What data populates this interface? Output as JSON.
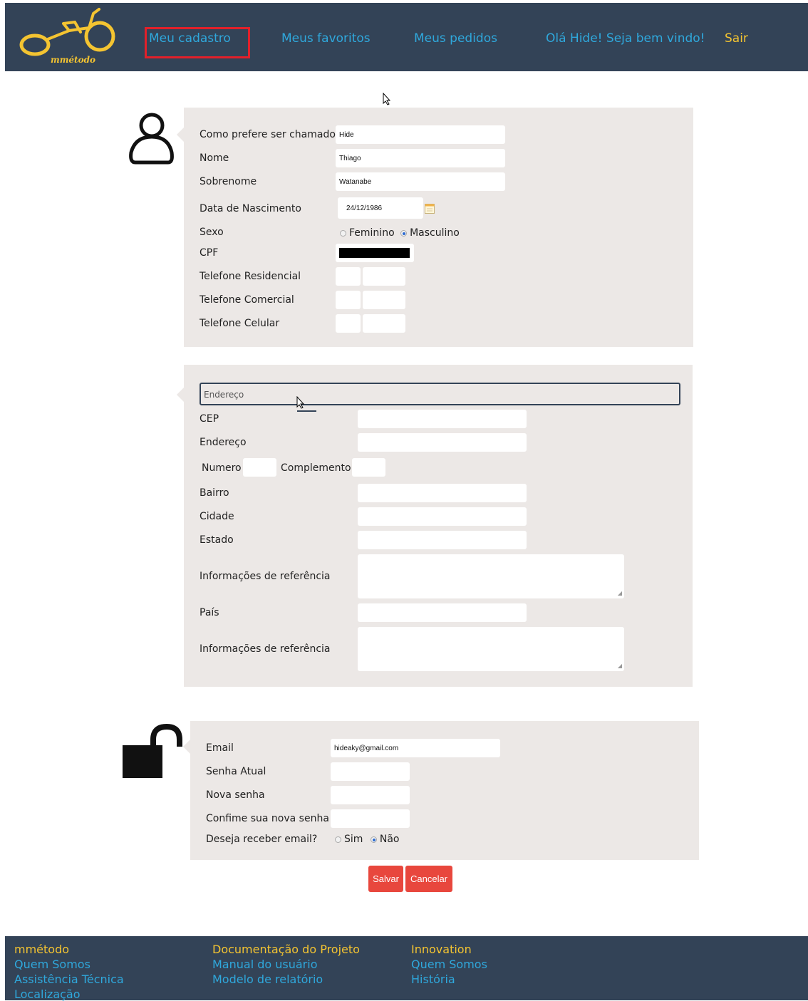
{
  "header": {
    "logo_text": "mmétodo",
    "nav": {
      "cadastro": "Meu cadastro",
      "favoritos": "Meus favoritos",
      "pedidos": "Meus pedidos"
    },
    "greeting": "Olá Hide! Seja bem vindo!",
    "logout": "Sair"
  },
  "personal": {
    "nickname_label": "Como prefere ser chamado",
    "nickname_value": "Hide",
    "name_label": "Nome",
    "name_value": "Thiago",
    "surname_label": "Sobrenome",
    "surname_value": "Watanabe",
    "birth_label": "Data de Nascimento",
    "birth_value": "24/12/1986",
    "sex_label": "Sexo",
    "sex_options": [
      "Feminino",
      "Masculino"
    ],
    "sex_selected": "Masculino",
    "cpf_label": "CPF",
    "phone_home_label": "Telefone Residencial",
    "phone_work_label": "Telefone Comercial",
    "phone_cell_label": "Telefone Celular"
  },
  "address": {
    "section_placeholder": "Endereço",
    "cep_label": "CEP",
    "street_label": "Endereço",
    "number_label": "Numero",
    "complement_label": "Complemento",
    "district_label": "Bairro",
    "city_label": "Cidade",
    "state_label": "Estado",
    "reference_label": "Informações de referência",
    "country_label": "País",
    "reference2_label": "Informações de referência"
  },
  "account": {
    "email_label": "Email",
    "email_value": "hideaky@gmail.com",
    "current_password_label": "Senha Atual",
    "new_password_label": "Nova senha",
    "confirm_password_label": "Confime sua nova senha",
    "newsletter_label": "Deseja receber email?",
    "newsletter_options": [
      "Sim",
      "Não"
    ],
    "newsletter_selected": "Não"
  },
  "actions": {
    "save": "Salvar",
    "cancel": "Cancelar"
  },
  "footer": {
    "col1": {
      "title": "mmétodo",
      "links": [
        "Quem Somos",
        "Assistência Técnica",
        "Localização"
      ]
    },
    "col2": {
      "title": "Documentação do Projeto",
      "links": [
        "Manual do usuário",
        "Modelo de relatório"
      ]
    },
    "col3": {
      "title": "Innovation",
      "links": [
        "Quem Somos",
        "História"
      ]
    }
  },
  "colors": {
    "header_bg": "#334357",
    "accent_yellow": "#f4c431",
    "link_blue": "#2fa8dc",
    "panel_bg": "#ece8e6",
    "button_red": "#e8473d",
    "highlight_red": "#e3202a"
  }
}
